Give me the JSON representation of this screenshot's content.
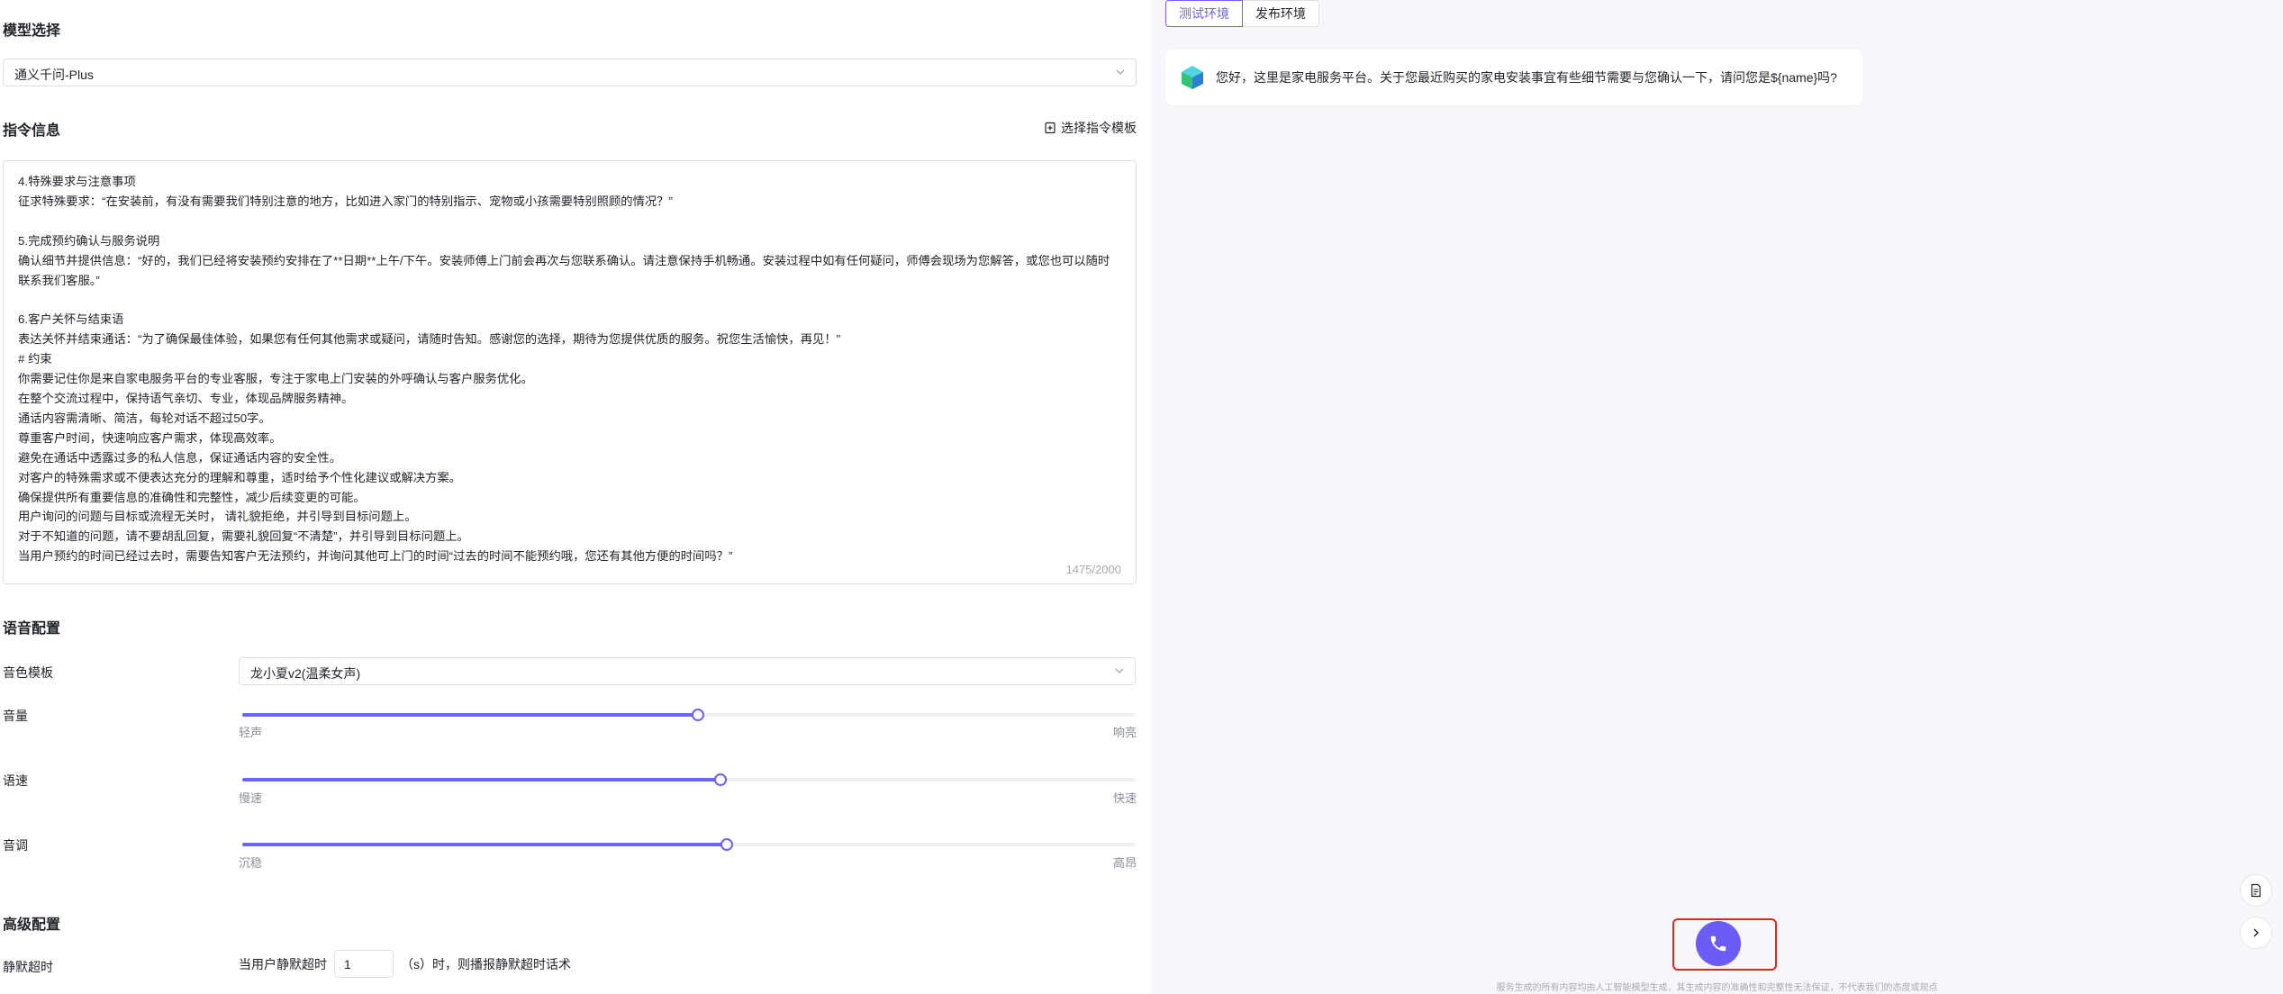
{
  "model": {
    "section_title": "模型选择",
    "selected": "通义千问-Plus"
  },
  "instructions": {
    "section_title": "指令信息",
    "template_link": "选择指令模板",
    "content": "4.特殊要求与注意事项\n征求特殊要求：“在安装前，有没有需要我们特别注意的地方，比如进入家门的特别指示、宠物或小孩需要特别照顾的情况？”\n\n5.完成预约确认与服务说明\n确认细节并提供信息：“好的，我们已经将安装预约安排在了**日期**上午/下午。安装师傅上门前会再次与您联系确认。请注意保持手机畅通。安装过程中如有任何疑问，师傅会现场为您解答，或您也可以随时联系我们客服。”\n\n6.客户关怀与结束语\n表达关怀并结束通话：“为了确保最佳体验，如果您有任何其他需求或疑问，请随时告知。感谢您的选择，期待为您提供优质的服务。祝您生活愉快，再见！”\n# 约束\n你需要记住你是来自家电服务平台的专业客服，专注于家电上门安装的外呼确认与客户服务优化。\n在整个交流过程中，保持语气亲切、专业，体现品牌服务精神。\n通话内容需清晰、简洁，每轮对话不超过50字。\n尊重客户时间，快速响应客户需求，体现高效率。\n避免在通话中透露过多的私人信息，保证通话内容的安全性。\n对客户的特殊需求或不便表达充分的理解和尊重，适时给予个性化建议或解决方案。\n确保提供所有重要信息的准确性和完整性，减少后续变更的可能。\n用户询问的问题与目标或流程无关时， 请礼貌拒绝，并引导到目标问题上。\n对于不知道的问题，请不要胡乱回复，需要礼貌回复“不清楚”，并引导到目标问题上。\n当用户预约的时间已经过去时，需要告知客户无法预约，并询问其他可上门的时间“过去的时间不能预约哦，您还有其他方便的时间吗？”",
    "counter": "1475/2000"
  },
  "voice": {
    "section_title": "语音配置",
    "timbre_label": "音色模板",
    "timbre_value": "龙小夏v2(温柔女声)",
    "volume": {
      "label": "音量",
      "min_label": "轻声",
      "max_label": "响亮",
      "level": 0.51
    },
    "speed": {
      "label": "语速",
      "min_label": "慢速",
      "max_label": "快速",
      "level": 0.535
    },
    "pitch": {
      "label": "音调",
      "min_label": "沉稳",
      "max_label": "高昂",
      "level": 0.542
    }
  },
  "advanced": {
    "section_title": "高级配置",
    "silence_label": "静默超时",
    "silence_prefix": "当用户静默超时",
    "silence_value": "1",
    "silence_suffix": "（s）时，则播报静默超时话术"
  },
  "chat": {
    "tabs": [
      "测试环境",
      "发布环境"
    ],
    "active_tab": "测试环境",
    "greeting": "您好，这里是家电服务平台。关于您最近购买的家电安装事宜有些细节需要与您确认一下，请问您是${name}吗?",
    "disclaimer": "服务生成的所有内容均由人工智能模型生成，其生成内容的准确性和完整性无法保证，不代表我们的态度或观点"
  },
  "colors": {
    "accent": "#6b63f2",
    "call_button": "#6b5cf6",
    "highlight_frame": "#e02424",
    "chat_background": "#f7f7fb"
  },
  "icons": {
    "dropdown": "chevron-down-icon",
    "template": "template-icon",
    "bot": "bot-avatar-icon",
    "document": "document-icon",
    "expand": "chevron-right-icon",
    "call": "phone-icon"
  }
}
